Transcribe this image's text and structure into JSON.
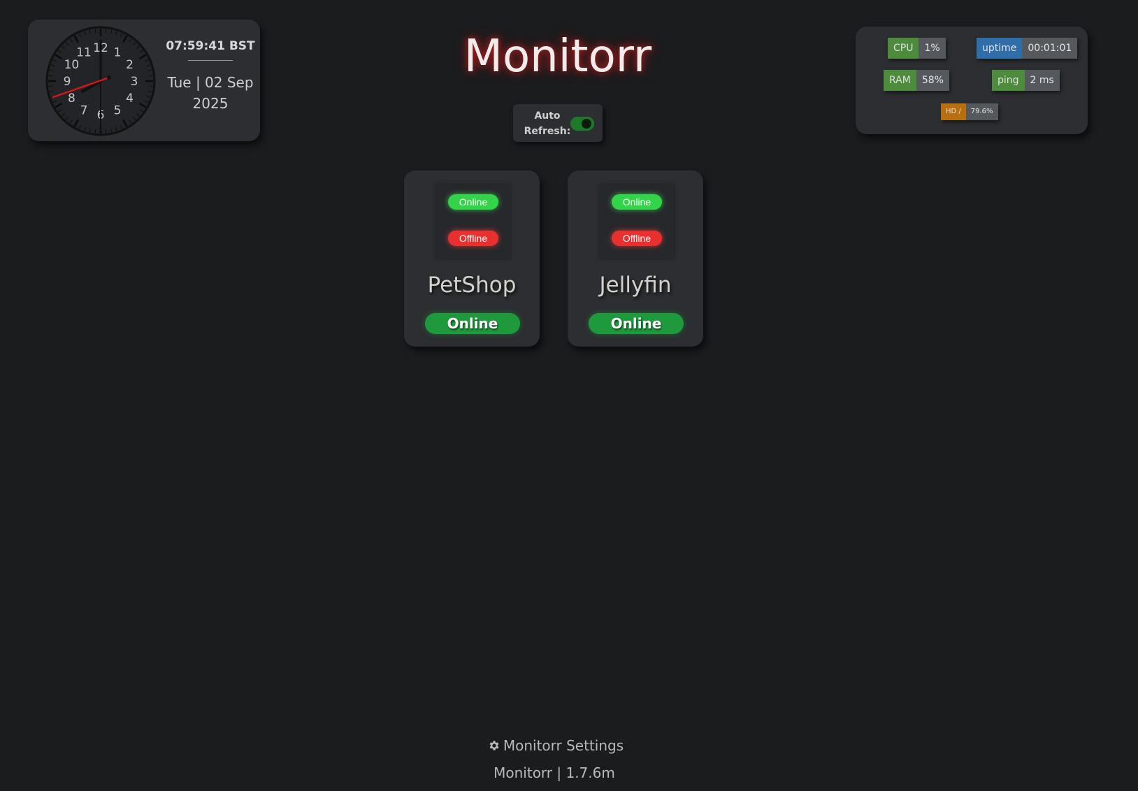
{
  "clock": {
    "time": "07:59:41 BST",
    "date": "Tue | 02 Sep 2025",
    "numerals": [
      "12",
      "1",
      "2",
      "3",
      "4",
      "5",
      "6",
      "7",
      "8",
      "9",
      "10",
      "11"
    ]
  },
  "header": {
    "title": "Monitorr"
  },
  "auto_refresh": {
    "label": "Auto Refresh:",
    "enabled": true
  },
  "stats": {
    "cpu": {
      "label": "CPU",
      "value": "1%",
      "color": "#4c8c3c"
    },
    "uptime": {
      "label": "uptime",
      "value": "00:01:01",
      "color": "#2f6ea8"
    },
    "ram": {
      "label": "RAM",
      "value": "58%",
      "color": "#4c8c3c"
    },
    "ping": {
      "label": "ping",
      "value": "2 ms",
      "color": "#4c8c3c"
    },
    "hd": {
      "label": "HD /",
      "value": "79.6%",
      "color": "#b8700f"
    }
  },
  "services": [
    {
      "name": "PetShop",
      "status": "Online",
      "image_online": "Online",
      "image_offline": "Offline"
    },
    {
      "name": "Jellyfin",
      "status": "Online",
      "image_online": "Online",
      "image_offline": "Offline"
    }
  ],
  "footer": {
    "settings_label": "Monitorr Settings",
    "settings_icon": "gear-icon",
    "version": "Monitorr | 1.7.6m"
  },
  "colors": {
    "background": "#1b1c1e",
    "panel": "#2c2e31",
    "online": "#1e9a3c",
    "title_glow": "#c81e1e"
  }
}
